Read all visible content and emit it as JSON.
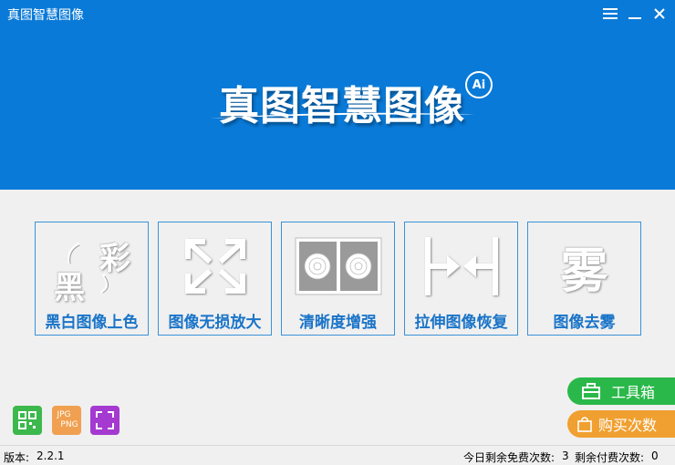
{
  "window": {
    "title": "真图智慧图像"
  },
  "logo": {
    "text": "真图智慧图像",
    "badge": "Ai"
  },
  "features": [
    {
      "label": "黑白图像上色",
      "icon": "colorize-icon",
      "glyph_a": "彩",
      "glyph_b": "黑"
    },
    {
      "label": "图像无损放大",
      "icon": "expand-arrows-icon"
    },
    {
      "label": "清晰度增强",
      "icon": "rose-compare-icon"
    },
    {
      "label": "拉伸图像恢复",
      "icon": "stretch-arrows-icon"
    },
    {
      "label": "图像去雾",
      "icon": "fog-icon",
      "glyph": "雾"
    }
  ],
  "side_buttons": {
    "toolbox": {
      "label": "工具箱",
      "color": "#2bb84a",
      "icon": "toolbox-icon"
    },
    "buy": {
      "label": "购买次数",
      "color": "#f0a030",
      "icon": "bag-icon"
    }
  },
  "small_icons": [
    {
      "icon": "qr-code-icon",
      "color": "#3cb84c"
    },
    {
      "icon": "format-convert-icon",
      "color": "#f0a050",
      "text_a": "JPG",
      "text_b": "PNG"
    },
    {
      "icon": "crop-icon",
      "color": "#a43ad0"
    }
  ],
  "statusbar": {
    "version_label": "版本:",
    "version": "2.2.1",
    "free_label": "今日剩余免费次数:",
    "free_count": "3",
    "paid_label": "剩余付费次数:",
    "paid_count": "0"
  },
  "colors": {
    "header": "#0a7ad8",
    "accent": "#1a74c8"
  }
}
